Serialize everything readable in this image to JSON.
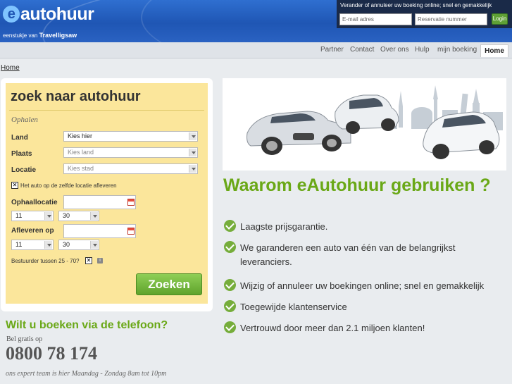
{
  "header": {
    "logo_text": "autohuur",
    "logo_e": "e",
    "tagline_prefix": "eenstukje van",
    "tagline_brand": "Travelligsaw",
    "login": {
      "title": "Verander of annuleer uw boeking online; snel en gemakkelijk",
      "email_placeholder": "E-mail adres",
      "reservation_placeholder": "Reservatie nummer",
      "button": "Login"
    }
  },
  "nav": {
    "items": [
      "Partner",
      "Contact",
      "Over ons",
      "Hulp",
      "mijn boeking"
    ],
    "home": "Home"
  },
  "breadcrumb": "Home",
  "search": {
    "title": "zoek naar autohuur",
    "section": "Ophalen",
    "land_label": "Land",
    "land_value": "Kies hier",
    "plaats_label": "Plaats",
    "plaats_placeholder": "Kies land",
    "locatie_label": "Locatie",
    "locatie_placeholder": "Kies stad",
    "same_location": "Het auto op de zelfde locatie afleveren",
    "pickup_label": "Ophaallocatie",
    "pickup_day": "11",
    "pickup_month": "30",
    "dropoff_label": "Afleveren op",
    "dropoff_day": "11",
    "dropoff_month": "30",
    "driver_age": "Bestuurder tussen 25 - 70?",
    "info": "i",
    "button": "Zoeken",
    "check_mark": "✕"
  },
  "phone": {
    "title": "Wilt u boeken via de telefoon?",
    "sub": "Bel gratis op",
    "number": "0800 78 174",
    "hours": "ons expert team is hier Maandag - Zondag 8am tot 10pm"
  },
  "main": {
    "why_title": "Waarom eAutohuur gebruiken ?",
    "benefits": [
      "Laagste prijsgarantie.",
      "We garanderen een auto van één van de belangrijkst leveranciers.",
      "Wijzig of annuleer uw boekingen online; snel en gemakkelijk",
      "Toegewijde klantenservice",
      "Vertrouwd door meer dan 2.1 miljoen klanten!"
    ]
  },
  "colors": {
    "brand_green": "#6aa817",
    "header_blue": "#2f6fd0",
    "panel_yellow": "#fbe69b"
  }
}
